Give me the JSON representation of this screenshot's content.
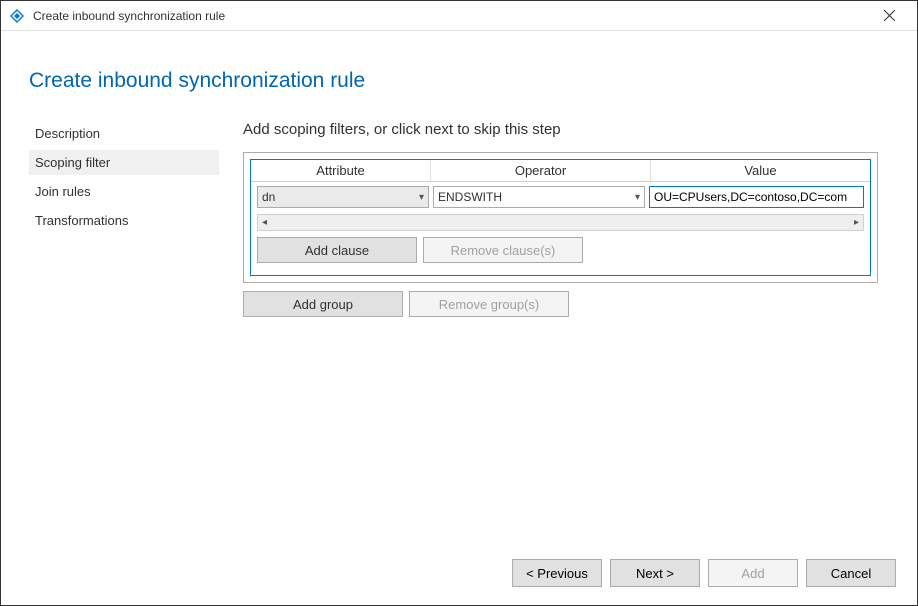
{
  "window": {
    "title": "Create inbound synchronization rule"
  },
  "page": {
    "heading": "Create inbound synchronization rule"
  },
  "sidebar": {
    "items": [
      {
        "label": "Description",
        "active": false
      },
      {
        "label": "Scoping filter",
        "active": true
      },
      {
        "label": "Join rules",
        "active": false
      },
      {
        "label": "Transformations",
        "active": false
      }
    ]
  },
  "main": {
    "step_title": "Add scoping filters, or click next to skip this step",
    "columns": {
      "attribute": "Attribute",
      "operator": "Operator",
      "value": "Value"
    },
    "row": {
      "attribute": "dn",
      "operator": "ENDSWITH",
      "value": "OU=CPUsers,DC=contoso,DC=com"
    },
    "buttons": {
      "add_clause": "Add clause",
      "remove_clause": "Remove clause(s)",
      "add_group": "Add group",
      "remove_group": "Remove group(s)"
    }
  },
  "footer": {
    "previous": "< Previous",
    "next": "Next >",
    "add": "Add",
    "cancel": "Cancel"
  }
}
